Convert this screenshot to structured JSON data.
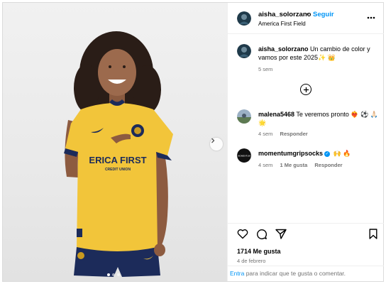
{
  "post": {
    "username": "aisha_solorzano",
    "separator": "•",
    "follow_label": "Seguir",
    "location": "America First Field",
    "more_icon": "more-horizontal-icon"
  },
  "caption": {
    "username": "aisha_solorzano",
    "text": "Un cambio de color y vamos por este 2025✨ 👑",
    "time": "5 sem"
  },
  "comments": [
    {
      "username": "malena5468",
      "text": "Te veremos pronto ❤️‍🔥 ⚽ 🙏🏻 🌟",
      "time": "4 sem",
      "reply_label": "Responder"
    },
    {
      "username": "momentumgripsocks",
      "verified": true,
      "text": "🙌 🔥",
      "time": "4 sem",
      "likes": "1 Me gusta",
      "reply_label": "Responder"
    }
  ],
  "stats": {
    "likes": "1714 Me gusta",
    "date": "4 de febrero"
  },
  "footer": {
    "link": "Entra",
    "text": " para indicar que te gusta o comentar."
  },
  "photo": {
    "jersey_sponsor": "ERICA FIRST",
    "jersey_sponsor_sub": "CREDIT UNION",
    "jersey_color": "#f2c53a",
    "shorts_color": "#1c2b5a"
  },
  "carousel": {
    "dots": 3,
    "active": 1
  },
  "colors": {
    "accent": "#0095f6",
    "muted": "#737373"
  }
}
